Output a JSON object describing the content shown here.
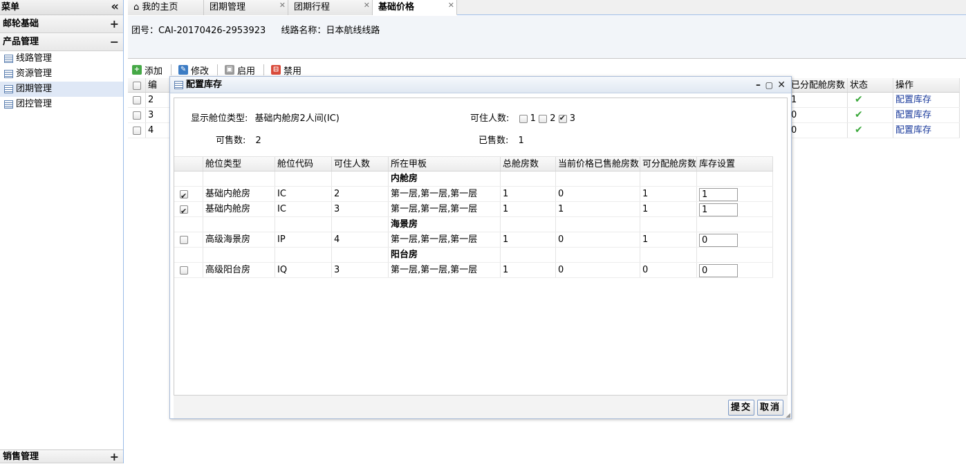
{
  "sidebar": {
    "title": "菜单",
    "collapse_icon": "«",
    "sections": [
      {
        "label": "邮轮基础",
        "toggle": "+"
      },
      {
        "label": "产品管理",
        "toggle": "−"
      }
    ],
    "items": [
      {
        "label": "线路管理"
      },
      {
        "label": "资源管理"
      },
      {
        "label": "团期管理"
      },
      {
        "label": "团控管理"
      }
    ],
    "bottom": {
      "label": "销售管理",
      "toggle": "+"
    }
  },
  "tabs": [
    {
      "label": "我的主页",
      "icon": "home-icon"
    },
    {
      "label": "团期管理"
    },
    {
      "label": "团期行程"
    },
    {
      "label": "基础价格"
    }
  ],
  "info": {
    "group_no": "团号：CAI-20170426-2953923",
    "route_name": "线路名称：日本航线线路"
  },
  "toolbar": {
    "add": "添加",
    "edit": "修改",
    "enable": "启用",
    "disable": "禁用"
  },
  "grid": {
    "headers": {
      "no": "编",
      "allocated": "已分配舱房数",
      "status": "状态",
      "action": "操作"
    },
    "rows": [
      {
        "no": "2",
        "allocated": "1",
        "action": "配置库存"
      },
      {
        "no": "3",
        "allocated": "0",
        "action": "配置库存"
      },
      {
        "no": "4",
        "allocated": "0",
        "action": "配置库存"
      }
    ]
  },
  "modal": {
    "title": "配置库存",
    "cabin_type_label": "显示舱位类型:",
    "cabin_type_value": "基础内舱房2人间(IC)",
    "occupancy_label": "可住人数:",
    "occupancy_options": [
      "1",
      "2",
      "3"
    ],
    "occupancy_checked": "3",
    "saleable_label": "可售数:",
    "saleable_value": "2",
    "sold_label": "已售数:",
    "sold_value": "1",
    "columns": [
      "舱位类型",
      "舱位代码",
      "可住人数",
      "所在甲板",
      "总舱房数",
      "当前价格已售舱房数",
      "可分配舱房数",
      "库存设置"
    ],
    "groups": [
      {
        "title": "内舱房",
        "rows": [
          {
            "type": "基础内舱房",
            "code": "IC",
            "capacity": "2",
            "deck": "第一层,第一层,第一层",
            "total": "1",
            "sold": "0",
            "allocatable": "1",
            "stock": "1",
            "checked": true
          },
          {
            "type": "基础内舱房",
            "code": "IC",
            "capacity": "3",
            "deck": "第一层,第一层,第一层",
            "total": "1",
            "sold": "1",
            "allocatable": "1",
            "stock": "1",
            "checked": true
          }
        ]
      },
      {
        "title": "海景房",
        "rows": [
          {
            "type": "高级海景房",
            "code": "IP",
            "capacity": "4",
            "deck": "第一层,第一层,第一层",
            "total": "1",
            "sold": "0",
            "allocatable": "1",
            "stock": "0",
            "checked": false
          }
        ]
      },
      {
        "title": "阳台房",
        "rows": [
          {
            "type": "高级阳台房",
            "code": "IQ",
            "capacity": "3",
            "deck": "第一层,第一层,第一层",
            "total": "1",
            "sold": "0",
            "allocatable": "0",
            "stock": "0",
            "checked": false
          }
        ]
      }
    ],
    "submit": "提交",
    "cancel": "取消"
  },
  "colors": {
    "accent": "#99bbe8",
    "link": "#1a3a9b",
    "ok": "#3aa83a"
  }
}
